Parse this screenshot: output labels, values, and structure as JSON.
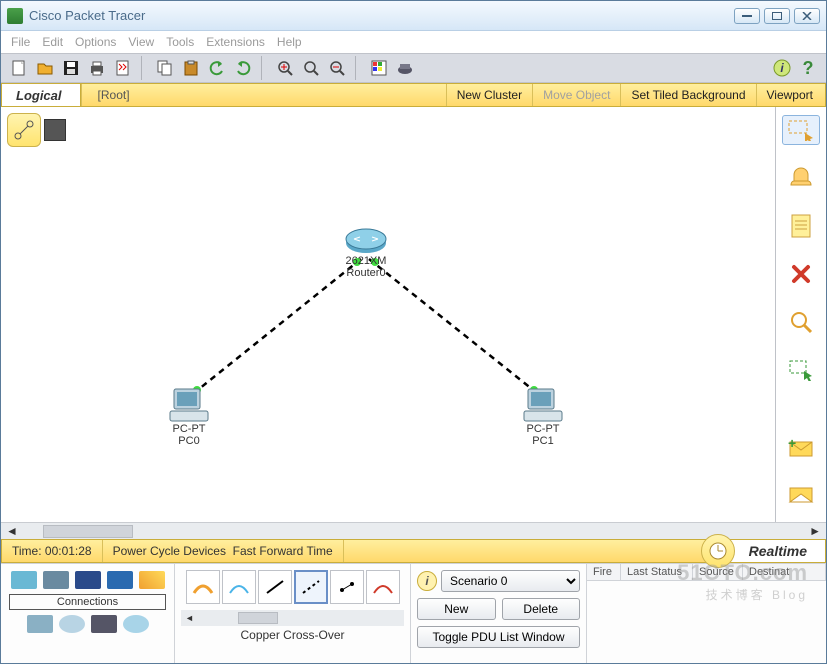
{
  "window": {
    "title": "Cisco Packet Tracer"
  },
  "menu": {
    "file": "File",
    "edit": "Edit",
    "options": "Options",
    "view": "View",
    "tools": "Tools",
    "extensions": "Extensions",
    "help": "Help"
  },
  "logical_bar": {
    "tab": "Logical",
    "root": "[Root]",
    "new_cluster": "New Cluster",
    "move_object": "Move Object",
    "set_bg": "Set Tiled Background",
    "viewport": "Viewport"
  },
  "topology": {
    "router": {
      "line1": "2621XM",
      "line2": "Router0"
    },
    "pc0": {
      "line1": "PC-PT",
      "line2": "PC0"
    },
    "pc1": {
      "line1": "PC-PT",
      "line2": "PC1"
    }
  },
  "realtime_bar": {
    "time_label": "Time: 00:01:28",
    "power_cycle": "Power Cycle Devices",
    "fast_forward": "Fast Forward Time",
    "tab": "Realtime"
  },
  "device_panel": {
    "label": "Connections"
  },
  "cable_panel": {
    "label": "Copper Cross-Over"
  },
  "scenario": {
    "selected": "Scenario 0",
    "new": "New",
    "delete": "Delete",
    "toggle": "Toggle PDU List Window"
  },
  "pdu": {
    "col_fire": "Fire",
    "col_last": "Last Status",
    "col_source": "Source",
    "col_dest": "Destinat"
  },
  "watermark": {
    "main": "51CTO.com",
    "sub": "技术博客   Blog"
  }
}
